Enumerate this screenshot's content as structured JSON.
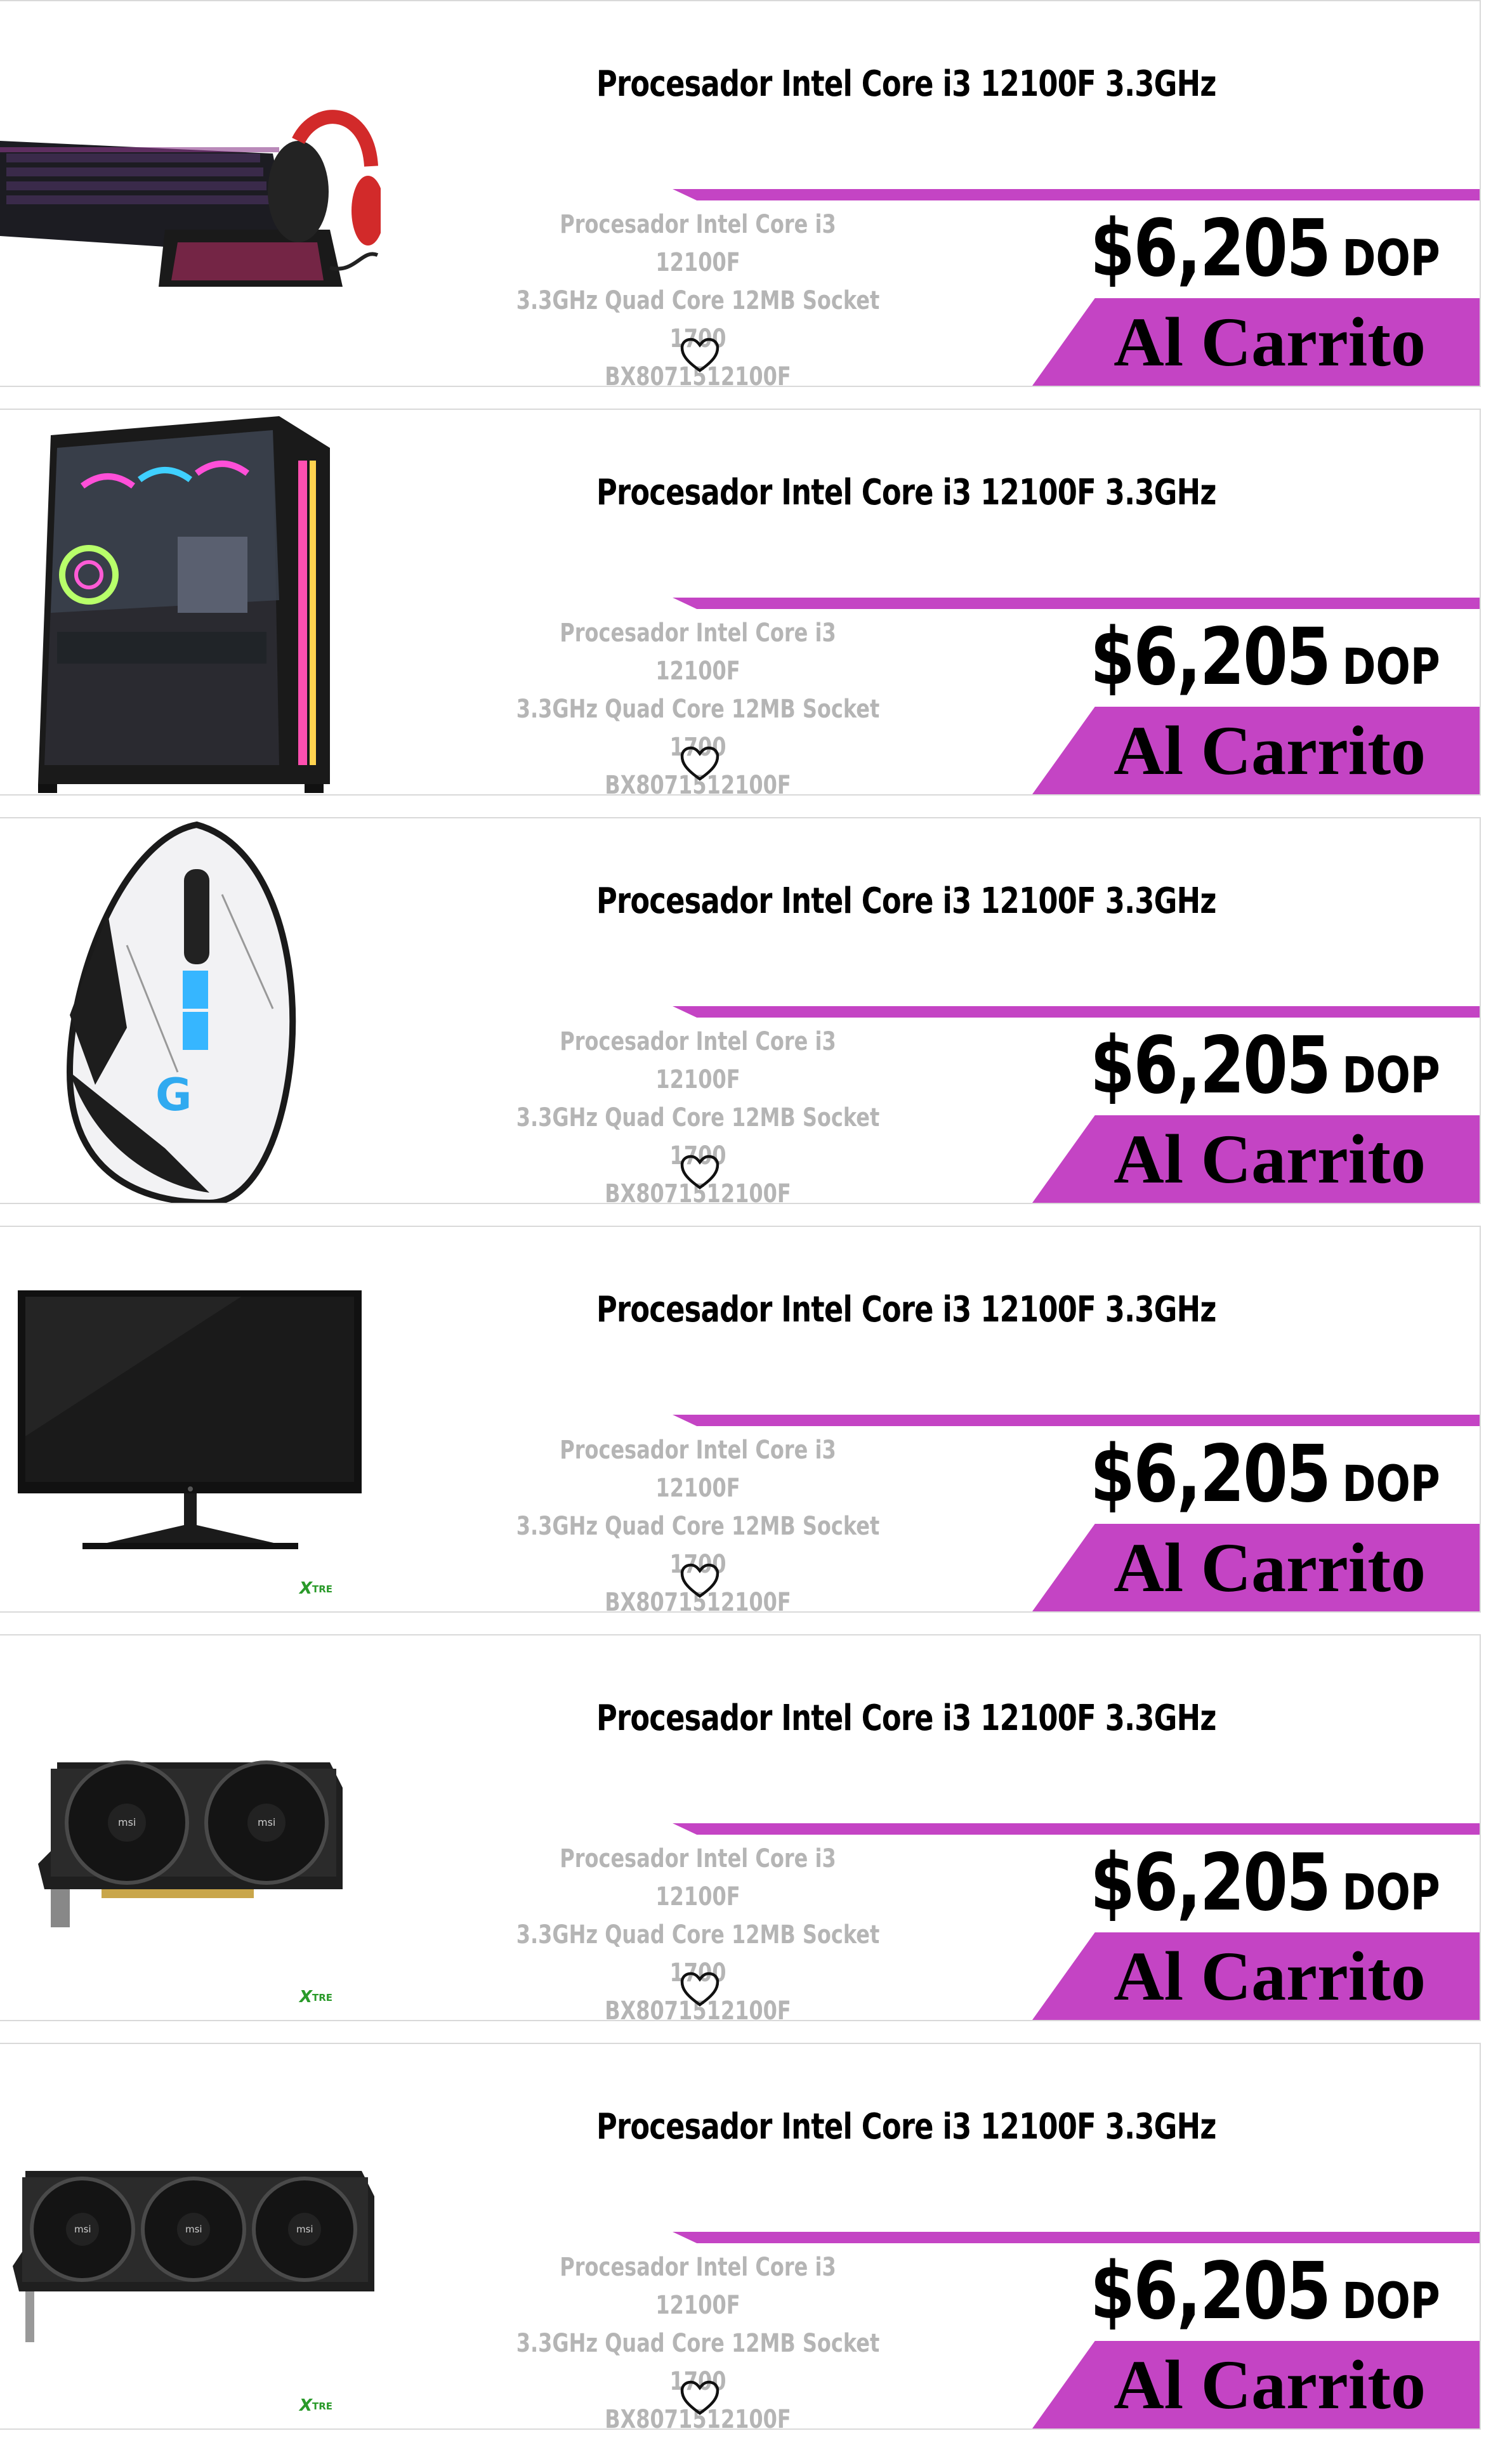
{
  "products": [
    {
      "image": "gaming-keyboard-headset-mouse-combo",
      "title": "Procesador Intel Core i3 12100F 3.3GHz",
      "description": [
        "Procesador Intel Core i3 12100F",
        "3.3GHz Quad Core 12MB Socket 1700",
        "BX8071512100F"
      ],
      "price": "$6,205",
      "currency": "DOP",
      "cart_label": "Al Carrito",
      "favorite_icon": "heart-icon",
      "badge": ""
    },
    {
      "image": "rgb-pc-tower-case",
      "title": "Procesador Intel Core i3 12100F 3.3GHz",
      "description": [
        "Procesador Intel Core i3 12100F",
        "3.3GHz Quad Core 12MB Socket 1700",
        "BX8071512100F"
      ],
      "price": "$6,205",
      "currency": "DOP",
      "cart_label": "Al Carrito",
      "favorite_icon": "heart-icon",
      "badge": ""
    },
    {
      "image": "logitech-gaming-mouse",
      "title": "Procesador Intel Core i3 12100F 3.3GHz",
      "description": [
        "Procesador Intel Core i3 12100F",
        "3.3GHz Quad Core 12MB Socket 1700",
        "BX8071512100F"
      ],
      "price": "$6,205",
      "currency": "DOP",
      "cart_label": "Al Carrito",
      "favorite_icon": "heart-icon",
      "badge": ""
    },
    {
      "image": "lg-monitor",
      "title": "Procesador Intel Core i3 12100F 3.3GHz",
      "description": [
        "Procesador Intel Core i3 12100F",
        "3.3GHz Quad Core 12MB Socket 1700",
        "BX8071512100F"
      ],
      "price": "$6,205",
      "currency": "DOP",
      "cart_label": "Al Carrito",
      "favorite_icon": "heart-icon",
      "badge": "XTRE"
    },
    {
      "image": "msi-dual-fan-graphics-card",
      "title": "Procesador Intel Core i3 12100F 3.3GHz",
      "description": [
        "Procesador Intel Core i3 12100F",
        "3.3GHz Quad Core 12MB Socket 1700",
        "BX8071512100F"
      ],
      "price": "$6,205",
      "currency": "DOP",
      "cart_label": "Al Carrito",
      "favorite_icon": "heart-icon",
      "badge": "XTRE"
    },
    {
      "image": "msi-triple-fan-graphics-card",
      "title": "Procesador Intel Core i3 12100F 3.3GHz",
      "description": [
        "Procesador Intel Core i3 12100F",
        "3.3GHz Quad Core 12MB Socket 1700",
        "BX8071512100F"
      ],
      "price": "$6,205",
      "currency": "DOP",
      "cart_label": "Al Carrito",
      "favorite_icon": "heart-icon",
      "badge": "XTRE"
    }
  ],
  "colors": {
    "accent": "#c444c4",
    "text": "#000000",
    "muted": "#b5b5b5",
    "border": "#d9d9d9"
  }
}
